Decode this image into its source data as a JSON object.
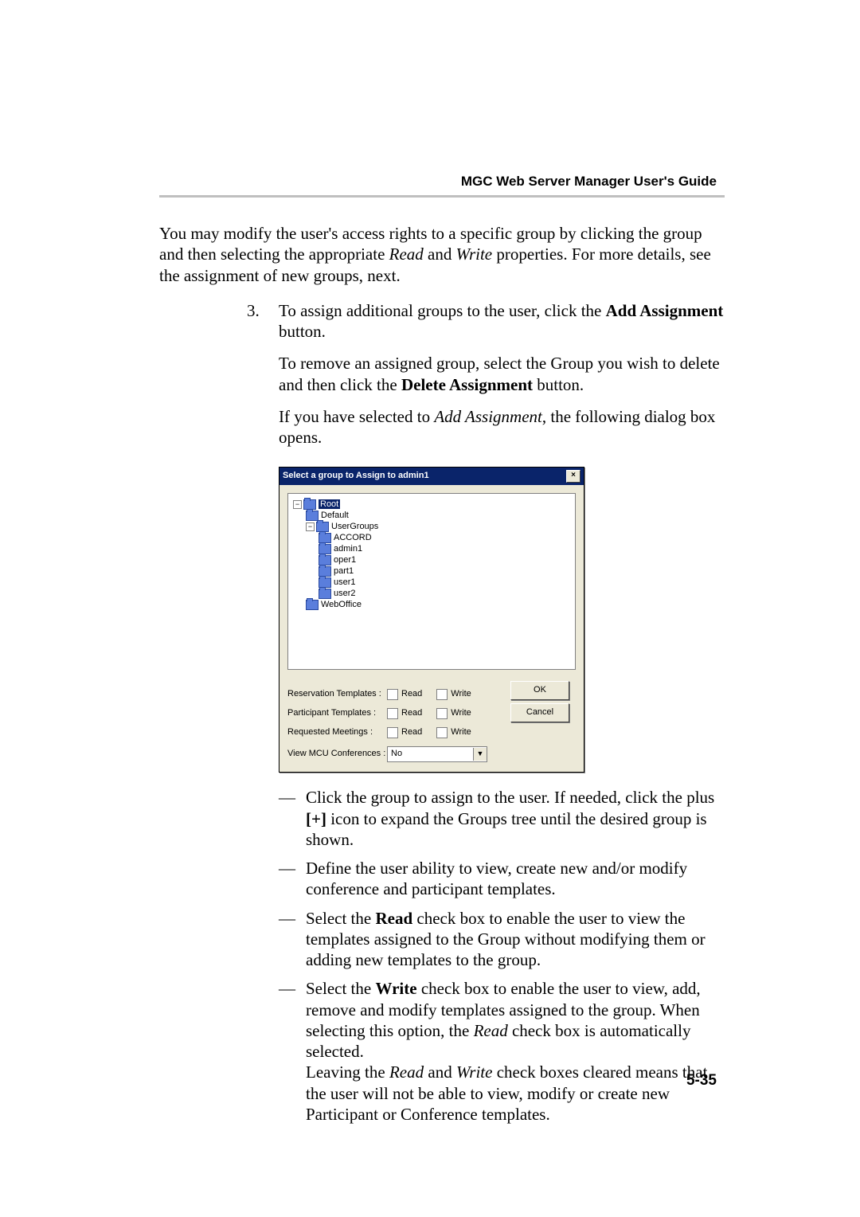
{
  "header": {
    "title": "MGC Web Server Manager User's Guide"
  },
  "intro_para": {
    "t1": "You may modify the user's access rights to a specific group by clicking the group and then selecting the appropriate ",
    "read": "Read",
    "t2": " and ",
    "write": "Write",
    "t3": " properties. For more details, see the assignment of new groups, next."
  },
  "step3": {
    "num": "3.",
    "p1a": "To assign additional groups to the user, click the ",
    "p1b": "Add Assignment",
    "p1c": " button.",
    "p2a": "To remove an assigned group, select the Group you wish to delete and then click the ",
    "p2b": "Delete Assignment",
    "p2c": " button.",
    "p3a": "If you have selected to ",
    "p3b": "Add Assignment",
    "p3c": ", the following dialog box opens."
  },
  "dialog": {
    "title": "Select a group to Assign to admin1",
    "close": "×",
    "tree": {
      "root": "Root",
      "default": "Default",
      "usergroups": "UserGroups",
      "accord": "ACCORD",
      "admin1": "admin1",
      "oper1": "oper1",
      "part1": "part1",
      "user1": "user1",
      "user2": "user2",
      "weboffice": "WebOffice"
    },
    "rows": {
      "res": "Reservation Templates :",
      "part": "Participant Templates  :",
      "req": "Requested Meetings   :",
      "view": "View MCU Conferences :"
    },
    "read": "Read",
    "write": "Write",
    "ok": "OK",
    "cancel": "Cancel",
    "select_value": "No"
  },
  "bullets": {
    "b1a": "Click the group to assign to the user. If needed, click the plus ",
    "b1b": "[+]",
    "b1c": " icon to expand the Groups tree until the desired group is shown.",
    "b2": "Define the user ability to view, create new and/or modify conference and participant templates.",
    "b3a": "Select the ",
    "b3b": "Read",
    "b3c": " check box to enable the user to view the templates assigned to the Group without modifying them or adding new templates to the group.",
    "b4a": "Select the ",
    "b4b": "Write",
    "b4c": " check box to enable the user to view, add, remove and modify templates assigned to the group. When selecting this option, the ",
    "b4d": "Read",
    "b4e": " check box is automatically selected.",
    "b4f": "Leaving the ",
    "b4g": "Read",
    "b4h": " and ",
    "b4i": "Write",
    "b4j": " check boxes cleared means that the user will not be able to view, modify or create new Participant or Conference templates."
  },
  "page_number": "5-35"
}
